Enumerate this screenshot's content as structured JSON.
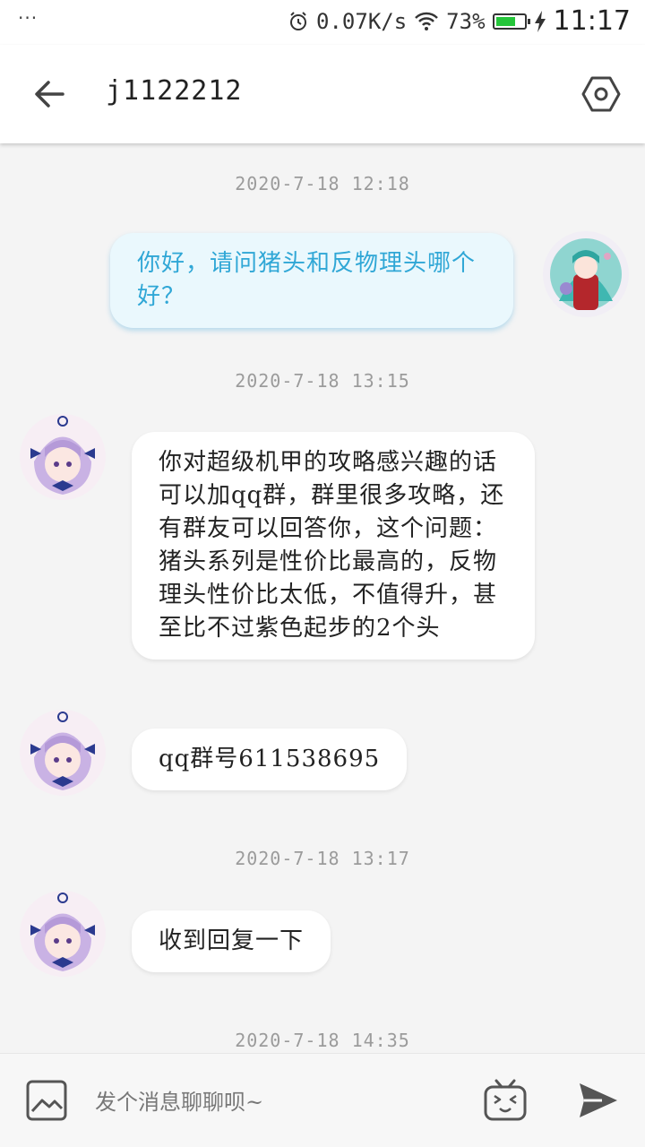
{
  "status_bar": {
    "dots": "···",
    "net_speed": "0.07K/s",
    "battery_percent": "73%",
    "battery_level": 0.73,
    "time": "11:17"
  },
  "header": {
    "title": "j1122212"
  },
  "messages": [
    {
      "timestamp": "2020-7-18 12:18"
    },
    {
      "direction": "outgoing",
      "text": "你好，请问猪头和反物理头哪个好？"
    },
    {
      "timestamp": "2020-7-18 13:15"
    },
    {
      "direction": "incoming",
      "text": "你对超级机甲的攻略感兴趣的话可以加qq群，群里很多攻略，还有群友可以回答你，这个问题：猪头系列是性价比最高的，反物理头性价比太低，不值得升，甚至比不过紫色起步的2个头"
    },
    {
      "direction": "incoming",
      "text": "qq群号611538695"
    },
    {
      "timestamp": "2020-7-18 13:17"
    },
    {
      "direction": "incoming",
      "text": "收到回复一下"
    },
    {
      "timestamp": "2020-7-18 14:35"
    }
  ],
  "input": {
    "placeholder": "发个消息聊聊呗~"
  },
  "colors": {
    "accent": "#30a7d6",
    "outgoing_bubble": "#eaf8fd",
    "incoming_bubble": "#ffffff",
    "battery": "#25c53a"
  },
  "icons": {
    "back": "arrow-left-icon",
    "settings": "hexagon-settings-icon",
    "image": "image-icon",
    "emoji": "bilibili-emoji-icon",
    "send": "send-icon"
  }
}
